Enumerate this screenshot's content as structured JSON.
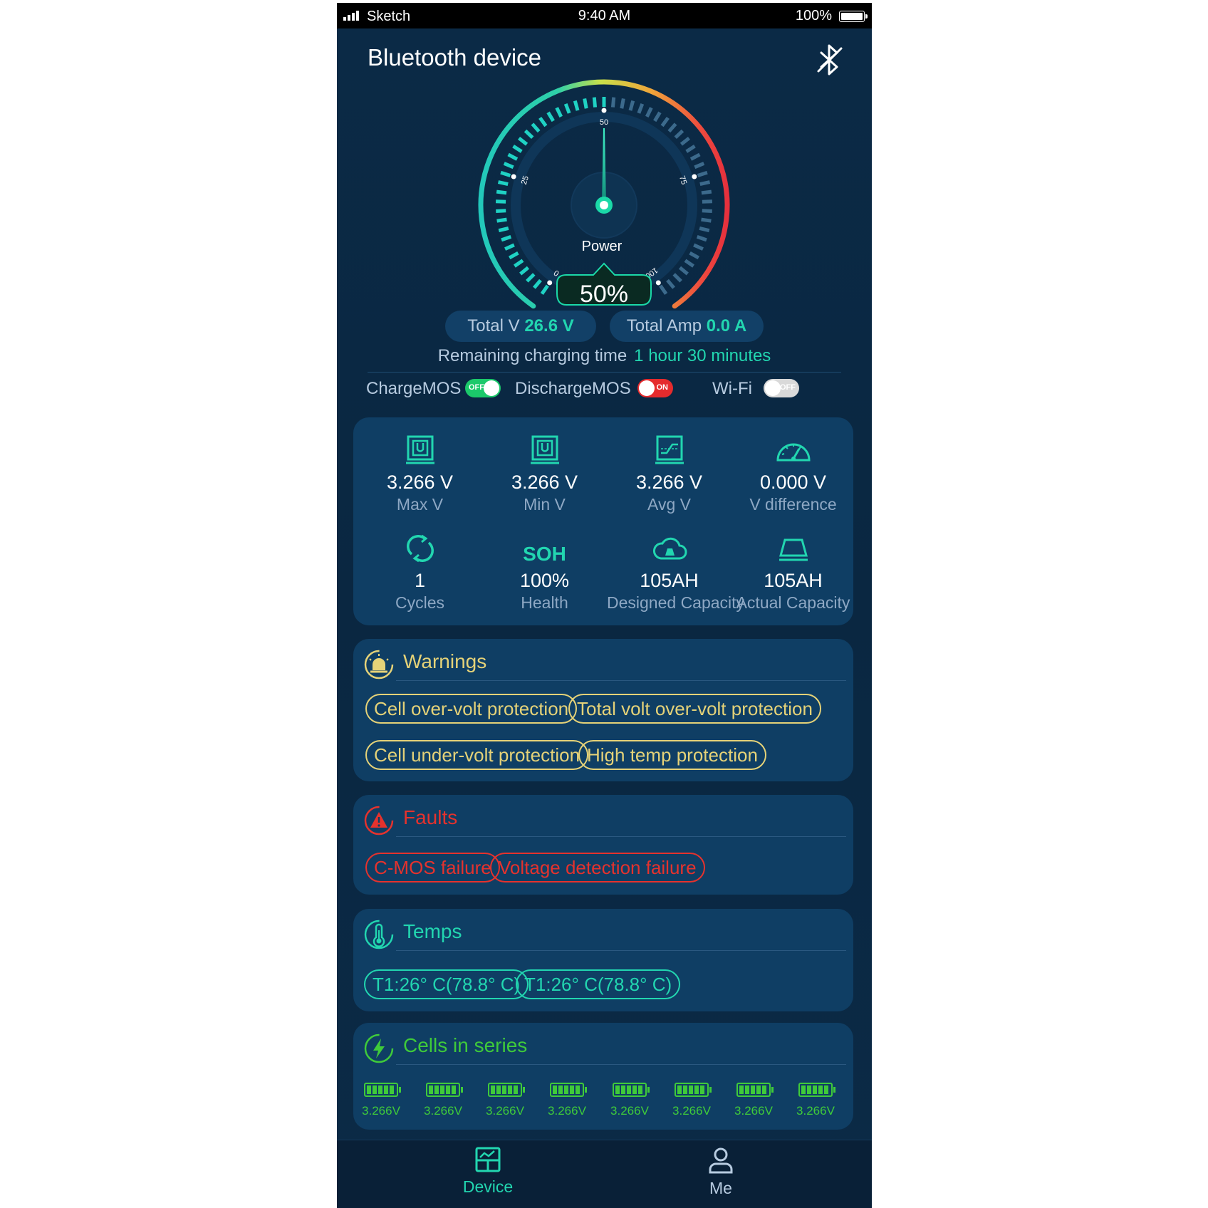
{
  "status_bar": {
    "carrier": "Sketch",
    "time": "9:40 AM",
    "battery": "100%"
  },
  "header": {
    "title": "Bluetooth device"
  },
  "gauge": {
    "label": "Power",
    "value_text": "50%",
    "level_percent": 50,
    "ticks": [
      "0",
      "25",
      "50",
      "75",
      "100"
    ]
  },
  "totals": {
    "voltage_label": "Total V",
    "voltage_value": "26.6 V",
    "amp_label": "Total Amp",
    "amp_value": "0.0 A"
  },
  "remaining": {
    "label": "Remaining charging time",
    "value": "1 hour 30 minutes"
  },
  "switches": {
    "charge": {
      "label": "ChargeMOS",
      "state": "OFF"
    },
    "discharge": {
      "label": "DischargeMOS",
      "state": "ON"
    },
    "wifi": {
      "label": "Wi-Fi",
      "state": "OFF"
    }
  },
  "metrics": [
    {
      "value": "3.266 V",
      "label": "Max V",
      "icon": "max-voltage-icon"
    },
    {
      "value": "3.266 V",
      "label": "Min V",
      "icon": "min-voltage-icon"
    },
    {
      "value": "3.266 V",
      "label": "Avg V",
      "icon": "avg-voltage-icon"
    },
    {
      "value": "0.000 V",
      "label": "V difference",
      "icon": "speedometer-icon"
    },
    {
      "value": "1",
      "label": "Cycles",
      "icon": "cycle-icon"
    },
    {
      "value": "100%",
      "label": "Health",
      "icon_text": "SOH"
    },
    {
      "value": "105AH",
      "label": "Designed Capacity",
      "icon": "cloud-capacity-icon"
    },
    {
      "value": "105AH",
      "label": "Actual Capacity",
      "icon": "capacity-icon"
    }
  ],
  "warnings": {
    "title": "Warnings",
    "items": [
      "Cell over-volt protection",
      "Total volt over-volt protection",
      "Cell under-volt protection",
      "High temp protection"
    ]
  },
  "faults": {
    "title": "Faults",
    "items": [
      "C-MOS failure",
      "Voltage  detection failure"
    ]
  },
  "temps": {
    "title": "Temps",
    "items": [
      "T1:26° C(78.8° C)",
      "T1:26° C(78.8° C)"
    ]
  },
  "cells": {
    "title": "Cells in series",
    "values": [
      "3.266V",
      "3.266V",
      "3.266V",
      "3.266V",
      "3.266V",
      "3.266V",
      "3.266V",
      "3.266V"
    ]
  },
  "tabbar": {
    "device": "Device",
    "me": "Me"
  },
  "colors": {
    "accent": "#22d6b0",
    "warning": "#e5d278",
    "fault": "#e5322d",
    "cells": "#3fca3a",
    "card": "#0f3e64"
  }
}
